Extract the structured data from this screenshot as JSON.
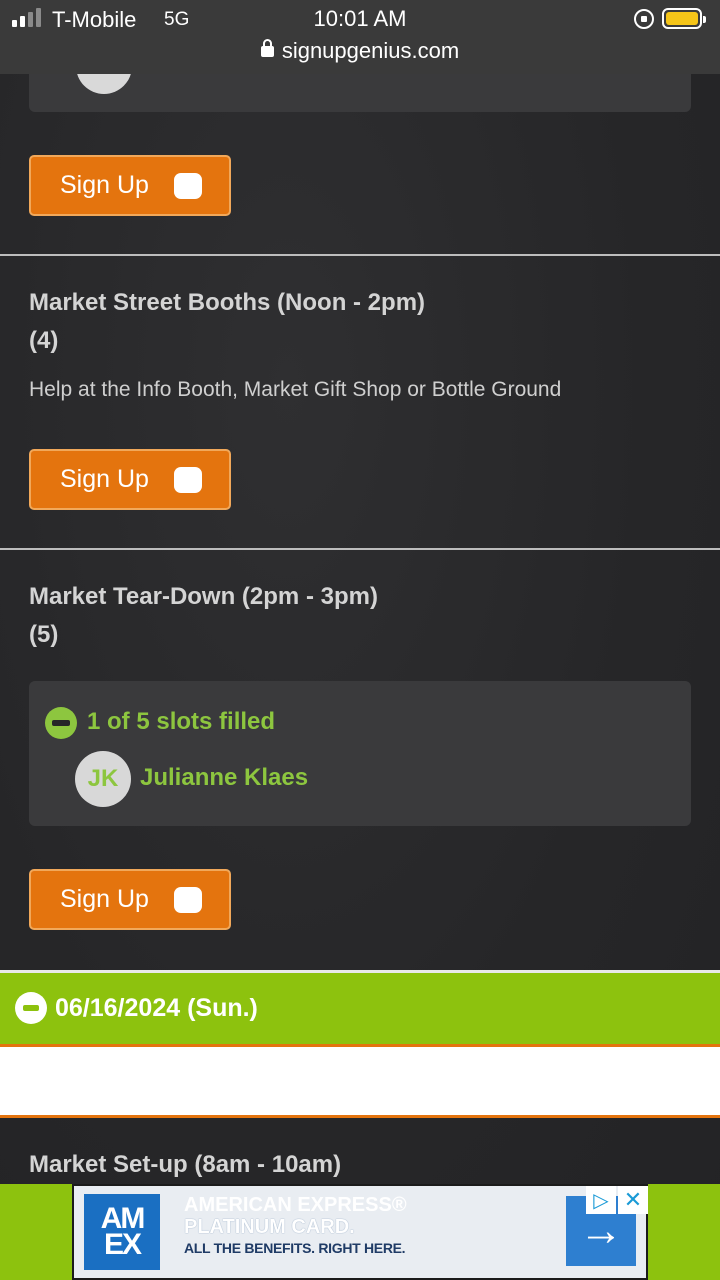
{
  "status_bar": {
    "carrier": "T-Mobile",
    "network": "5G",
    "time": "10:01 AM",
    "url": "signupgenius.com",
    "battery_color": "#f5c518"
  },
  "slots": [
    {
      "button_label": "Sign Up"
    },
    {
      "title": "Market Street Booths (Noon - 2pm)",
      "count": "(4)",
      "description": "Help at the Info Booth, Market Gift Shop or Bottle Ground",
      "button_label": "Sign Up"
    },
    {
      "title": "Market Tear-Down (2pm - 3pm)",
      "count": "(5)",
      "filled_text": "1 of 5 slots filled",
      "volunteer": {
        "initials": "JK",
        "name": "Julianne Klaes"
      },
      "button_label": "Sign Up"
    }
  ],
  "date_header": {
    "label": "06/16/2024 (Sun.)",
    "color": "#8dc20e"
  },
  "next_slot": {
    "title": "Market Set-up (8am - 10am)"
  },
  "ad": {
    "logo_line1": "AM",
    "logo_line2": "EX",
    "headline1": "AMERICAN EXPRESS®",
    "headline2": "PLATINUM CARD.",
    "subline": "ALL THE BENEFITS. RIGHT HERE.",
    "arrow": "→",
    "choice_icon": "▷",
    "close_icon": "✕"
  },
  "colors": {
    "accent_orange": "#e4740e",
    "accent_green": "#8dc63f"
  }
}
